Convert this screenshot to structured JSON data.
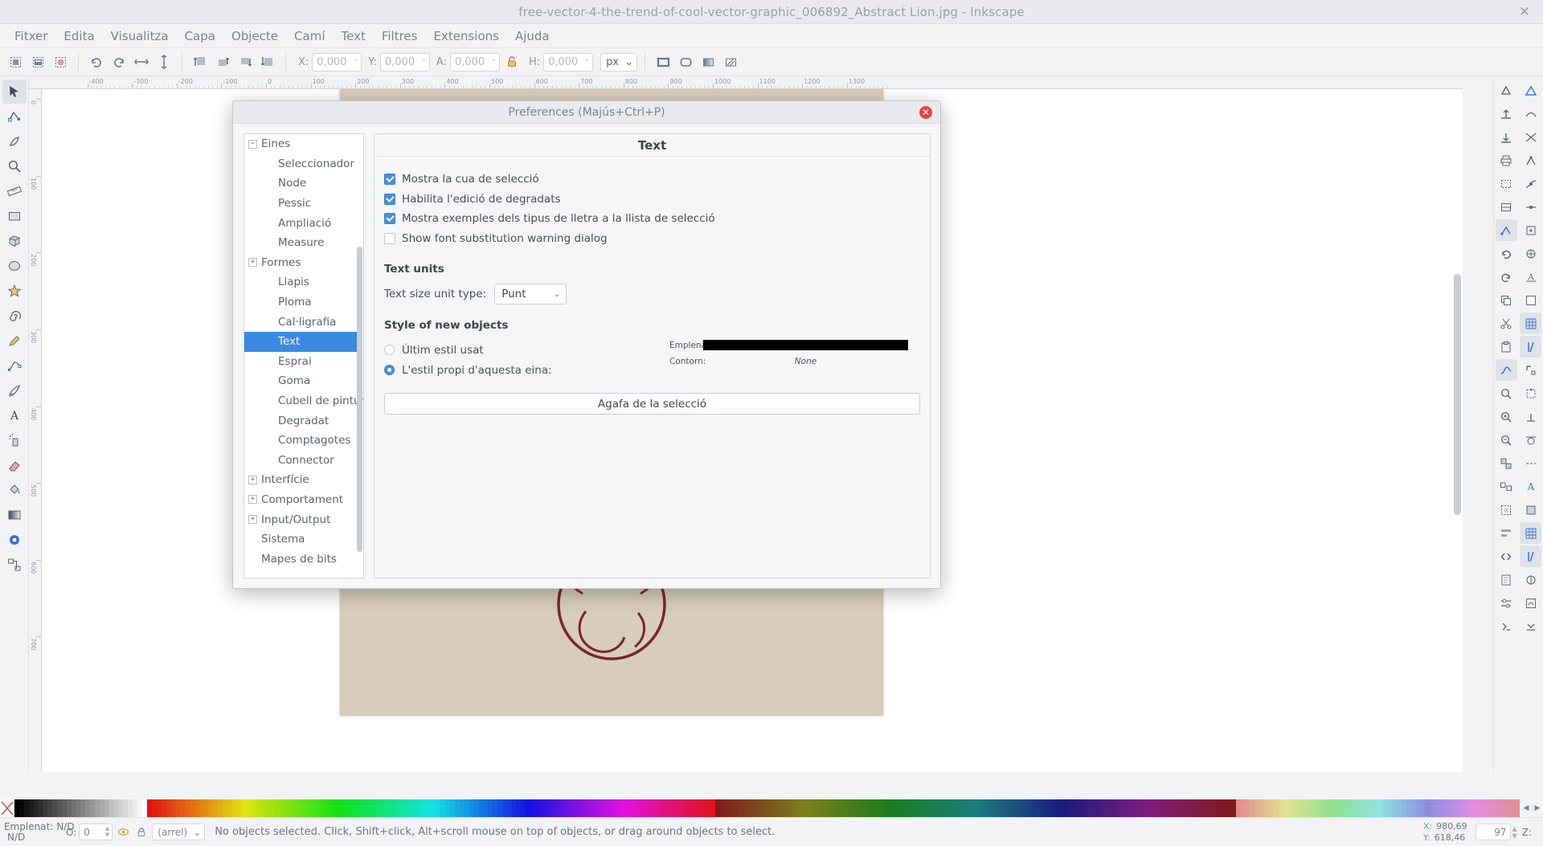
{
  "window": {
    "title": "free-vector-4-the-trend-of-cool-vector-graphic_006892_Abstract Lion.jpg - Inkscape",
    "close_glyph": "✕"
  },
  "menubar": {
    "items": [
      "Fitxer",
      "Edita",
      "Visualitza",
      "Capa",
      "Objecte",
      "Camí",
      "Text",
      "Filtres",
      "Extensions",
      "Ajuda"
    ]
  },
  "toolbar": {
    "fields": [
      {
        "label": "X:",
        "value": "0,000"
      },
      {
        "label": "Y:",
        "value": "0,000"
      },
      {
        "label": "A:",
        "value": "0,000"
      },
      {
        "label": "H:",
        "value": "0,000"
      }
    ],
    "unit": "px",
    "chevron": "⌄",
    "up_arrow": "⌃"
  },
  "rulers": {
    "horizontal": [
      "-400",
      "-300",
      "-200",
      "-100",
      "0",
      "100",
      "200",
      "300",
      "400",
      "500",
      "600",
      "700",
      "800",
      "900",
      "1000",
      "1100",
      "1200",
      "1300"
    ],
    "vertical": [
      "0",
      "100",
      "200",
      "300",
      "400",
      "500",
      "600",
      "700"
    ]
  },
  "prefs": {
    "title": "Preferences (Majús+Ctrl+P)",
    "close_glyph": "✕",
    "pane_title": "Text",
    "tree": [
      {
        "label": "Eines",
        "level": 1,
        "expander": "−",
        "selected": false
      },
      {
        "label": "Seleccionador",
        "level": 2,
        "expander": null,
        "selected": false
      },
      {
        "label": "Node",
        "level": 2,
        "expander": null,
        "selected": false
      },
      {
        "label": "Pessic",
        "level": 2,
        "expander": null,
        "selected": false
      },
      {
        "label": "Ampliació",
        "level": 2,
        "expander": null,
        "selected": false
      },
      {
        "label": "Measure",
        "level": 2,
        "expander": null,
        "selected": false
      },
      {
        "label": "Formes",
        "level": 1,
        "expander": "+",
        "selected": false
      },
      {
        "label": "Llapis",
        "level": 2,
        "expander": null,
        "selected": false
      },
      {
        "label": "Ploma",
        "level": 2,
        "expander": null,
        "selected": false
      },
      {
        "label": "Cal·ligrafia",
        "level": 2,
        "expander": null,
        "selected": false
      },
      {
        "label": "Text",
        "level": 2,
        "expander": null,
        "selected": true
      },
      {
        "label": "Esprai",
        "level": 2,
        "expander": null,
        "selected": false
      },
      {
        "label": "Goma",
        "level": 2,
        "expander": null,
        "selected": false
      },
      {
        "label": "Cubell de pintura",
        "level": 2,
        "expander": null,
        "selected": false
      },
      {
        "label": "Degradat",
        "level": 2,
        "expander": null,
        "selected": false
      },
      {
        "label": "Comptagotes",
        "level": 2,
        "expander": null,
        "selected": false
      },
      {
        "label": "Connector",
        "level": 2,
        "expander": null,
        "selected": false
      },
      {
        "label": "Interfície",
        "level": 1,
        "expander": "+",
        "selected": false
      },
      {
        "label": "Comportament",
        "level": 1,
        "expander": "+",
        "selected": false
      },
      {
        "label": "Input/Output",
        "level": 1,
        "expander": "+",
        "selected": false
      },
      {
        "label": "Sistema",
        "level": 1,
        "expander": null,
        "selected": false
      },
      {
        "label": "Mapes de bits",
        "level": 1,
        "expander": null,
        "selected": false
      }
    ],
    "checkboxes": [
      {
        "label": "Mostra la cua de selecció",
        "checked": true
      },
      {
        "label": "Habilita l'edició de degradats",
        "checked": true
      },
      {
        "label": "Mostra exemples dels tipus de lletra a la llista de selecció",
        "checked": true
      },
      {
        "label": "Show font substitution warning dialog",
        "checked": false
      }
    ],
    "text_units": {
      "heading": "Text units",
      "unit_label": "Text size unit type:",
      "unit_value": "Punt",
      "chevron": "⌄"
    },
    "style_of_new_objects": {
      "heading": "Style of new objects",
      "options": [
        {
          "label": "Últim estil usat",
          "selected": false
        },
        {
          "label": "L'estil propi d'aquesta eina:",
          "selected": true
        }
      ],
      "preview": {
        "fill_label": "Emplenat:",
        "fill_color": "#000000",
        "stroke_label": "Contorn:",
        "stroke_value": "None"
      },
      "take_from_selection": "Agafa de la selecció"
    }
  },
  "statusbar": {
    "fill_label": "Emplenat:",
    "fill_value": "N/D",
    "stroke_label": "",
    "stroke_value": "N/D",
    "opacity_label": "O:",
    "opacity_value": "0",
    "layer_value": "(arrel)",
    "layer_chevron": "⌄",
    "message": "No objects selected. Click, Shift+click, Alt+scroll mouse on top of objects, or drag around objects to select.",
    "coords": {
      "x_label": "X:",
      "x_value": "980,69",
      "y_label": "Y:",
      "y_value": "618,46"
    },
    "zoom_label": "Z:",
    "zoom_value": "97"
  },
  "icons": {
    "select_all": "select-all-icon",
    "select_all_layers": "select-all-layers-icon",
    "deselect": "deselect-icon",
    "rotate_ccw": "rotate-counterclockwise-icon",
    "rotate_cw": "rotate-clockwise-icon",
    "flip_h": "flip-horizontal-icon",
    "flip_v": "flip-vertical-icon",
    "raise_top": "raise-to-top-icon",
    "raise": "raise-icon",
    "lower": "lower-icon",
    "lower_bottom": "lower-to-bottom-icon",
    "lock_ratio": "lock-aspect-ratio-icon"
  }
}
